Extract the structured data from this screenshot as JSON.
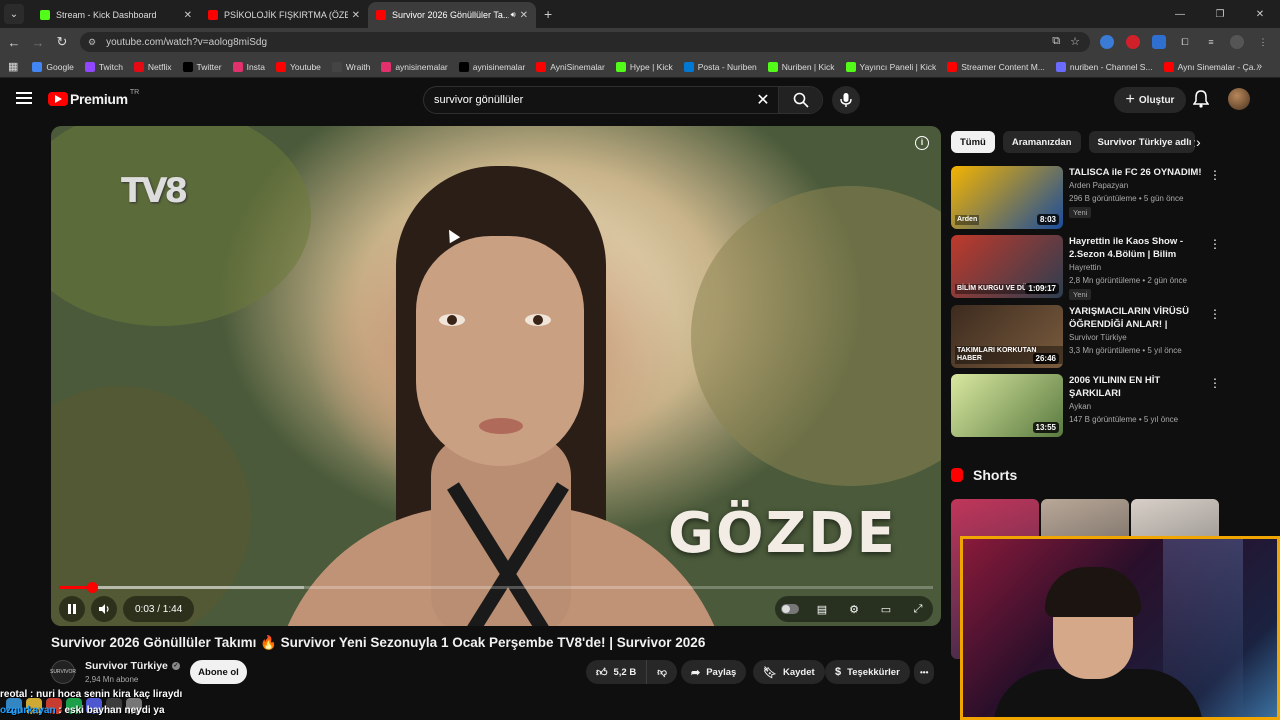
{
  "browser": {
    "tabs": [
      {
        "title": "Stream - Kick Dashboard",
        "icon": "kick-icon",
        "color": "#53fc18",
        "active": false
      },
      {
        "title": "PSİKOLOJİK FIŞKIRTMA (ÖZET...",
        "icon": "youtube-icon",
        "color": "#ff0000",
        "active": false
      },
      {
        "title": "Survivor 2026 Gönüllüler Ta...",
        "icon": "youtube-icon",
        "color": "#ff0000",
        "active": true
      }
    ],
    "new_tab": "+",
    "url": "youtube.com/watch?v=aolog8miSdg",
    "bookmarks": [
      {
        "label": "Google",
        "icon": "google-icon",
        "color": "#4285f4"
      },
      {
        "label": "Twitch",
        "icon": "twitch-icon",
        "color": "#9146ff"
      },
      {
        "label": "Netflix",
        "icon": "netflix-icon",
        "color": "#e50914"
      },
      {
        "label": "Twitter",
        "icon": "x-icon",
        "color": "#000000"
      },
      {
        "label": "Insta",
        "icon": "instagram-icon",
        "color": "#e1306c"
      },
      {
        "label": "Youtube",
        "icon": "youtube-icon",
        "color": "#ff0000"
      },
      {
        "label": "Wraith",
        "icon": "wraith-icon",
        "color": "#444444"
      },
      {
        "label": "aynisinemalar",
        "icon": "instagram-icon",
        "color": "#e1306c"
      },
      {
        "label": "aynisinemalar",
        "icon": "x-icon",
        "color": "#000000"
      },
      {
        "label": "AyniSinemalar",
        "icon": "youtube-icon",
        "color": "#ff0000"
      },
      {
        "label": "Hype | Kick",
        "icon": "kick-icon",
        "color": "#53fc18"
      },
      {
        "label": "Posta - Nuriben",
        "icon": "outlook-icon",
        "color": "#0078d4"
      },
      {
        "label": "Nuriben | Kick",
        "icon": "kick-icon",
        "color": "#53fc18"
      },
      {
        "label": "Yayıncı Paneli | Kick",
        "icon": "kick-icon",
        "color": "#53fc18"
      },
      {
        "label": "Streamer Content M...",
        "icon": "youtube-icon",
        "color": "#ff0000"
      },
      {
        "label": "nuriben - Channel S...",
        "icon": "channel-icon",
        "color": "#6b6bff"
      },
      {
        "label": "Aynı Sinemalar - Ça...",
        "icon": "youtube-icon",
        "color": "#ff0000"
      }
    ]
  },
  "youtube": {
    "logo_word": "Premium",
    "logo_sup": "TR",
    "search_query": "survivor gönüllüler",
    "create_label": "Oluştur",
    "player": {
      "channel_logo_text": "TV8",
      "overlay_name": "GÖZDE",
      "time": "0:03 / 1:44",
      "progress_played": 0.038,
      "progress_loaded": 0.28
    },
    "video_title": "Survivor 2026 Gönüllüler Takımı 🔥 Survivor Yeni Sezonuyla 1 Ocak Perşembe TV8'de! | Survivor 2026",
    "channel": {
      "name": "Survivor Türkiye",
      "subs": "2,94 Mn abone",
      "avatar_text": "SURVIVOR",
      "subscribe_label": "Abone ol"
    },
    "actions": {
      "likes": "5,2 B",
      "share": "Paylaş",
      "save": "Kaydet",
      "thanks": "Teşekkürler",
      "more": "•••"
    },
    "chips": [
      "Tümü",
      "Aramanızdan",
      "Survivor Türkiye adlı yük..."
    ],
    "recommendations": [
      {
        "title": "TALISCA ile FC 26 OYNADIM!",
        "channel": "Arden Papazyan",
        "meta": "296 B görüntüleme • 5 gün önce",
        "badge": "Yeni",
        "duration": "8:03",
        "thumb_text": "Arden",
        "thumb_colors": [
          "#f4b400",
          "#1a4c9c"
        ]
      },
      {
        "title": "Hayrettin ile Kaos Show - 2.Sezon 4.Bölüm | Bilim Kurgu...",
        "channel": "Hayrettin",
        "meta": "2,8 Mn görüntüleme • 2 gün önce",
        "badge": "Yeni",
        "duration": "1:09:17",
        "thumb_text": "BİLİM KURGU VE DÜNYAMIZ",
        "thumb_colors": [
          "#c0392b",
          "#2c3e50"
        ]
      },
      {
        "title": "YARIŞMACILARIN VİRÜSÜ ÖĞRENDİĞİ ANLAR! | SURVİV...",
        "channel": "Survivor Türkiye",
        "meta": "3,3 Mn görüntüleme • 5 yıl önce",
        "badge": "",
        "duration": "26:46",
        "thumb_text": "TAKIMLARI KORKUTAN HABER",
        "thumb_colors": [
          "#3d2b1f",
          "#7a5c3e"
        ]
      },
      {
        "title": "2006 YILININ EN HİT ŞARKILARI",
        "channel": "Aykan",
        "meta": "147 B görüntüleme • 5 yıl önce",
        "badge": "",
        "duration": "13:55",
        "thumb_text": "",
        "thumb_colors": [
          "#d9e8a0",
          "#5a7a40"
        ]
      }
    ],
    "shorts_title": "Shorts"
  },
  "chat": [
    {
      "user": "reotal",
      "message": "nuri hoca senin kira kaç liraydı"
    },
    {
      "user": "ozgurkayan",
      "message": "eski bayhan neydi ya"
    }
  ]
}
